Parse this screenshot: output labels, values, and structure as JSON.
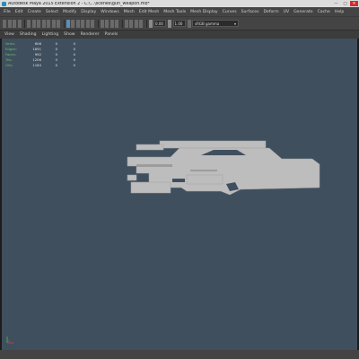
{
  "window": {
    "title": "Autodesk Maya 2015 Extension 2 - C:\\...\\scenes\\gun_weapon.mb*",
    "minimize": "—",
    "maximize": "□",
    "close": "✕"
  },
  "menu": {
    "items": [
      {
        "label": "File"
      },
      {
        "label": "Edit"
      },
      {
        "label": "Create"
      },
      {
        "label": "Select"
      },
      {
        "label": "Modify"
      },
      {
        "label": "Display"
      },
      {
        "label": "Windows"
      },
      {
        "label": "Mesh"
      },
      {
        "label": "Edit Mesh"
      },
      {
        "label": "Mesh Tools"
      },
      {
        "label": "Mesh Display"
      },
      {
        "label": "Curves"
      },
      {
        "label": "Surfaces"
      },
      {
        "label": "Deform"
      },
      {
        "label": "UV"
      },
      {
        "label": "Generate"
      },
      {
        "label": "Cache"
      },
      {
        "label": "Help"
      }
    ]
  },
  "toolbar": {
    "field_a": "0.00",
    "field_b": "1.00",
    "colorspace": "sRGB gamma",
    "dropdown_arrow": "▾"
  },
  "panel_menu": {
    "items": [
      {
        "label": "View"
      },
      {
        "label": "Shading"
      },
      {
        "label": "Lighting"
      },
      {
        "label": "Show"
      },
      {
        "label": "Renderer"
      },
      {
        "label": "Panels"
      }
    ]
  },
  "hud": {
    "rows": [
      {
        "label": "Verts:",
        "v1": "606",
        "v2": "0",
        "v3": "0"
      },
      {
        "label": "Edges:",
        "v1": "1691",
        "v2": "0",
        "v3": "0"
      },
      {
        "label": "Faces:",
        "v1": "992",
        "v2": "0",
        "v3": "0"
      },
      {
        "label": "Tris:",
        "v1": "1206",
        "v2": "0",
        "v3": "0"
      },
      {
        "label": "UVs:",
        "v1": "1184",
        "v2": "0",
        "v3": "0"
      }
    ]
  },
  "colors": {
    "viewport_bg": "#404f5e",
    "model_fill": "#bdbdbd",
    "model_shade": "#9c9c9c",
    "hud_label": "#6ac26a",
    "axis_x": "#d04040",
    "axis_y": "#40c040",
    "axis_z": "#4060d0"
  }
}
